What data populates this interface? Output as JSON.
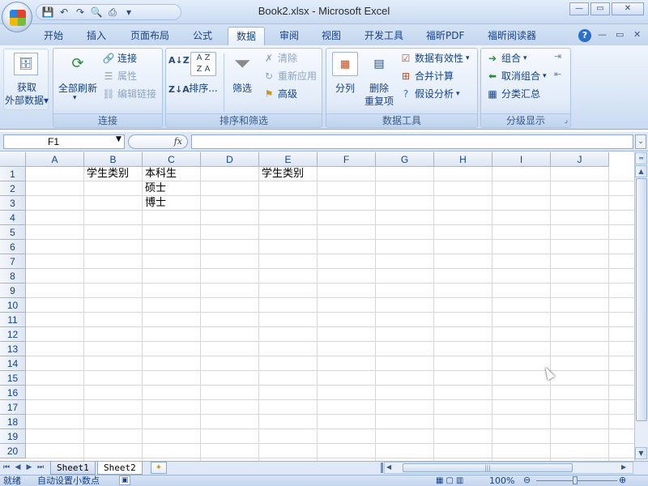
{
  "window": {
    "title": "Book2.xlsx - Microsoft Excel",
    "controls": {
      "minimize": "—",
      "restore": "▭",
      "close": "✕"
    }
  },
  "quick_access": [
    {
      "name": "save-icon",
      "glyph": "💾"
    },
    {
      "name": "undo-icon",
      "glyph": "↶"
    },
    {
      "name": "redo-icon",
      "glyph": "↷"
    },
    {
      "name": "print-preview-icon",
      "glyph": "🔍"
    },
    {
      "name": "quick-print-icon",
      "glyph": "⎙"
    },
    {
      "name": "customize-qat-icon",
      "glyph": "▾"
    }
  ],
  "ribbon_tabs": [
    {
      "label": "开始",
      "active": false
    },
    {
      "label": "插入",
      "active": false
    },
    {
      "label": "页面布局",
      "active": false
    },
    {
      "label": "公式",
      "active": false
    },
    {
      "label": "数据",
      "active": true
    },
    {
      "label": "审阅",
      "active": false
    },
    {
      "label": "视图",
      "active": false
    },
    {
      "label": "开发工具",
      "active": false
    },
    {
      "label": "福昕PDF",
      "active": false
    },
    {
      "label": "福昕阅读器",
      "active": false
    }
  ],
  "ribbon_right": {
    "help": "?",
    "minimize": "—",
    "restore": "▭",
    "close": "✕"
  },
  "ribbon": {
    "get_external": {
      "line1": "获取",
      "line2": "外部数据"
    },
    "connections": {
      "label": "连接",
      "refresh_all": "全部刷新",
      "connections": "连接",
      "properties": "属性",
      "edit_links": "编辑链接"
    },
    "sort_filter": {
      "label": "排序和筛选",
      "sort": "排序...",
      "filter": "筛选",
      "clear": "清除",
      "reapply": "重新应用",
      "advanced": "高级"
    },
    "data_tools": {
      "label": "数据工具",
      "text_to_columns": "分列",
      "remove_dup_1": "删除",
      "remove_dup_2": "重复项",
      "validation": "数据有效性",
      "consolidate": "合并计算",
      "whatif": "假设分析"
    },
    "outline": {
      "label": "分级显示",
      "group": "组合",
      "ungroup": "取消组合",
      "subtotal": "分类汇总"
    }
  },
  "formula_bar": {
    "name_box": "F1",
    "fx": "fx",
    "value": ""
  },
  "columns": [
    "A",
    "B",
    "C",
    "D",
    "E",
    "F",
    "G",
    "H",
    "I",
    "J"
  ],
  "rows": [
    "1",
    "2",
    "3",
    "4",
    "5",
    "6",
    "7",
    "8",
    "9",
    "10",
    "11",
    "12",
    "13",
    "14",
    "15",
    "16",
    "17",
    "18",
    "19",
    "20"
  ],
  "cells": {
    "B1": "学生类别",
    "C1": "本科生",
    "C2": "硕士",
    "C3": "博士",
    "E1": "学生类别"
  },
  "sheet_tabs": [
    {
      "label": "Sheet1",
      "active": false
    },
    {
      "label": "Sheet2",
      "active": true
    }
  ],
  "status_bar": {
    "ready": "就绪",
    "auto_decimal": "自动设置小数点",
    "zoom": "100%"
  }
}
